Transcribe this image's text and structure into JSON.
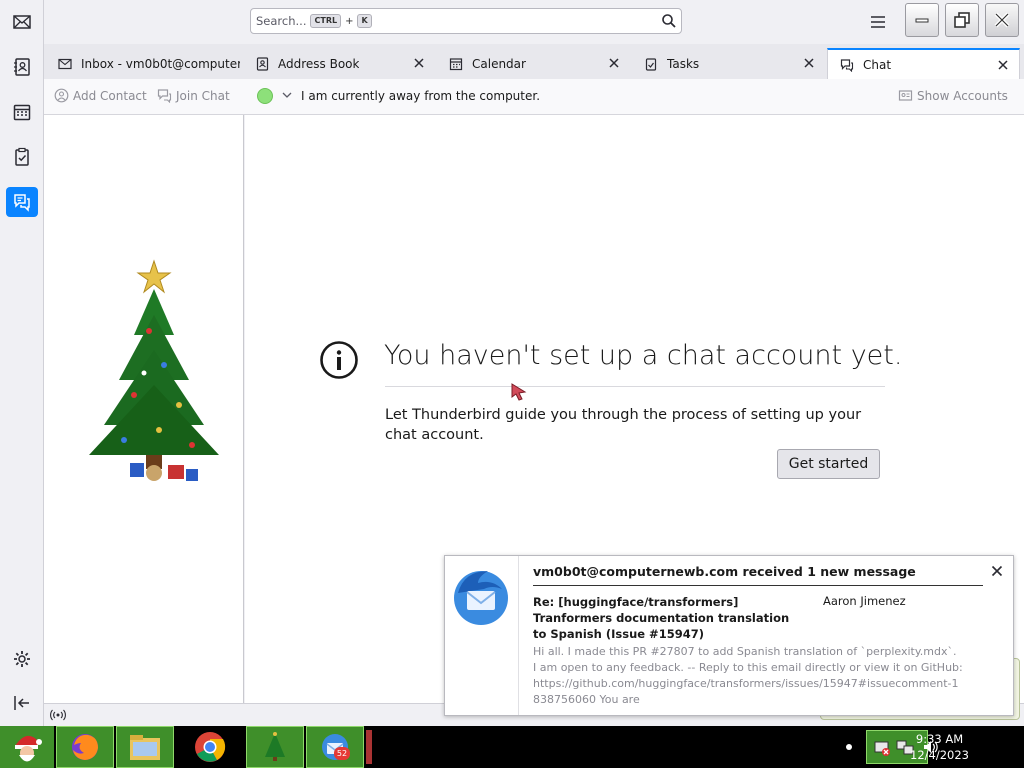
{
  "search": {
    "placeholder": "Search...",
    "key1": "CTRL",
    "plus": "+",
    "key2": "K"
  },
  "tabs": [
    {
      "label": "Inbox - vm0b0t@computernewb.com",
      "icon": "mail-icon"
    },
    {
      "label": "Address Book",
      "icon": "address-book-icon"
    },
    {
      "label": "Calendar",
      "icon": "calendar-icon"
    },
    {
      "label": "Tasks",
      "icon": "tasks-icon"
    },
    {
      "label": "Chat",
      "icon": "chat-icon",
      "selected": true
    }
  ],
  "chat_toolbar": {
    "add_contact": "Add Contact",
    "join_chat": "Join Chat",
    "status_message": "I am currently away from the computer.",
    "show_accounts": "Show Accounts"
  },
  "main": {
    "title": "You haven't set up a chat account yet.",
    "description": "Let Thunderbird guide you through the process of setting up your chat account.",
    "get_started": "Get started"
  },
  "notification": {
    "heading": "vm0b0t@computernewb.com received 1 new message",
    "subject": "Re: [huggingface/transformers] Tranformers documentation translation to Spanish (Issue #15947)",
    "sender": "Aaron Jimenez",
    "preview": "Hi all. I made this PR #27807 to add Spanish translation of `perplexity.mdx`. I am open to any feedback. -- Reply to this email directly or view it on GitHub: https://github.com/huggingface/transformers/issues/15947#issuecomment-1838756060 You are"
  },
  "taskbar": {
    "time": "9:33 AM",
    "date": "12/4/2023",
    "mail_badge": "52"
  },
  "colors": {
    "accent": "#0a84ff",
    "taskbar_green": "#3f8f2a",
    "status_available": "#8de07a"
  }
}
